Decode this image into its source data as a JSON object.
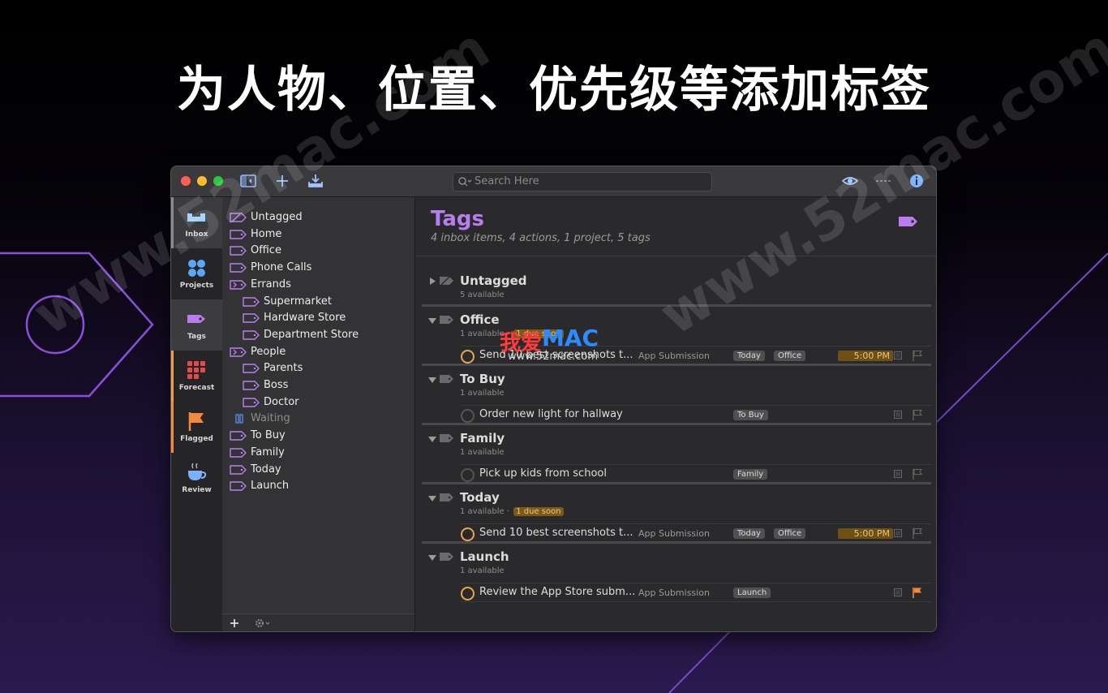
{
  "headline": "为人物、位置、优先级等添加标签",
  "watermark_text": "www.52mac.com",
  "overlay": {
    "brand_cn": "我爱",
    "brand_en": "MAC",
    "url": "www.52mac.com"
  },
  "colors": {
    "accent_purple": "#b77ef0",
    "due_orange": "#e9a64a",
    "flag_orange": "#f08a3c",
    "inbox_blue": "#9ad0ff",
    "projects_blue": "#5aa8f5",
    "forecast_red": "#e5484d"
  },
  "toolbar": {
    "search_placeholder": "Search Here"
  },
  "sidebar": [
    {
      "label": "Inbox",
      "icon": "inbox-icon",
      "bar_color": "#8a8a8a"
    },
    {
      "label": "Projects",
      "icon": "projects-icon",
      "bar_color": ""
    },
    {
      "label": "Tags",
      "icon": "tag-icon",
      "bar_color": ""
    },
    {
      "label": "Forecast",
      "icon": "forecast-icon",
      "bar_color": "#e8a04c"
    },
    {
      "label": "Flagged",
      "icon": "flag-icon",
      "bar_color": "#f08a3c"
    },
    {
      "label": "Review",
      "icon": "coffee-cup-icon",
      "bar_color": ""
    }
  ],
  "tag_list": [
    {
      "label": "Untagged",
      "indent": 0,
      "icon": "untagged-icon",
      "dim": false
    },
    {
      "label": "Home",
      "indent": 0,
      "icon": "tag-outline-icon",
      "dim": false
    },
    {
      "label": "Office",
      "indent": 0,
      "icon": "tag-outline-icon",
      "dim": false
    },
    {
      "label": "Phone Calls",
      "indent": 0,
      "icon": "tag-outline-icon",
      "dim": false
    },
    {
      "label": "Errands",
      "indent": 0,
      "icon": "tag-group-icon",
      "dim": false
    },
    {
      "label": "Supermarket",
      "indent": 1,
      "icon": "tag-outline-icon",
      "dim": false
    },
    {
      "label": "Hardware Store",
      "indent": 1,
      "icon": "tag-outline-icon",
      "dim": false
    },
    {
      "label": "Department Store",
      "indent": 1,
      "icon": "tag-outline-icon",
      "dim": false
    },
    {
      "label": "People",
      "indent": 0,
      "icon": "tag-group-icon",
      "dim": false
    },
    {
      "label": "Parents",
      "indent": 1,
      "icon": "tag-outline-icon",
      "dim": false
    },
    {
      "label": "Boss",
      "indent": 1,
      "icon": "tag-outline-icon",
      "dim": false
    },
    {
      "label": "Doctor",
      "indent": 1,
      "icon": "tag-outline-icon",
      "dim": false
    },
    {
      "label": "Waiting",
      "indent": 0,
      "icon": "pause-icon",
      "dim": true
    },
    {
      "label": "To Buy",
      "indent": 0,
      "icon": "tag-outline-icon",
      "dim": false
    },
    {
      "label": "Family",
      "indent": 0,
      "icon": "tag-outline-icon",
      "dim": false
    },
    {
      "label": "Today",
      "indent": 0,
      "icon": "tag-outline-icon",
      "dim": false
    },
    {
      "label": "Launch",
      "indent": 0,
      "icon": "tag-outline-icon",
      "dim": false
    }
  ],
  "main": {
    "title": "Tags",
    "subtitle": "4 inbox items, 4 actions, 1 project, 5 tags",
    "groups": [
      {
        "name": "Untagged",
        "meta": "5 available",
        "due": "",
        "collapsed": true,
        "rows": []
      },
      {
        "name": "Office",
        "meta": "1 available",
        "due": "1 due soon",
        "collapsed": false,
        "rows": [
          {
            "title": "Send 10 best screenshots t...",
            "project": "App Submission",
            "tags": [
              "Today",
              "Office"
            ],
            "time": "5:00 PM",
            "due": true,
            "flagged": false
          }
        ]
      },
      {
        "name": "To Buy",
        "meta": "1 available",
        "due": "",
        "collapsed": false,
        "rows": [
          {
            "title": "Order new light for hallway",
            "project": "",
            "tags": [
              "To Buy"
            ],
            "time": "",
            "due": false,
            "flagged": false
          }
        ]
      },
      {
        "name": "Family",
        "meta": "1 available",
        "due": "",
        "collapsed": false,
        "rows": [
          {
            "title": "Pick up kids from school",
            "project": "",
            "tags": [
              "Family"
            ],
            "time": "",
            "due": false,
            "flagged": false
          }
        ]
      },
      {
        "name": "Today",
        "meta": "1 available",
        "due": "1 due soon",
        "collapsed": false,
        "rows": [
          {
            "title": "Send 10 best screenshots t...",
            "project": "App Submission",
            "tags": [
              "Today",
              "Office"
            ],
            "time": "5:00 PM",
            "due": true,
            "flagged": false
          }
        ]
      },
      {
        "name": "Launch",
        "meta": "1 available",
        "due": "",
        "collapsed": false,
        "rows": [
          {
            "title": "Review the App Store subm...",
            "project": "App Submission",
            "tags": [
              "Launch"
            ],
            "time": "",
            "due": true,
            "flagged": true
          }
        ]
      }
    ]
  }
}
